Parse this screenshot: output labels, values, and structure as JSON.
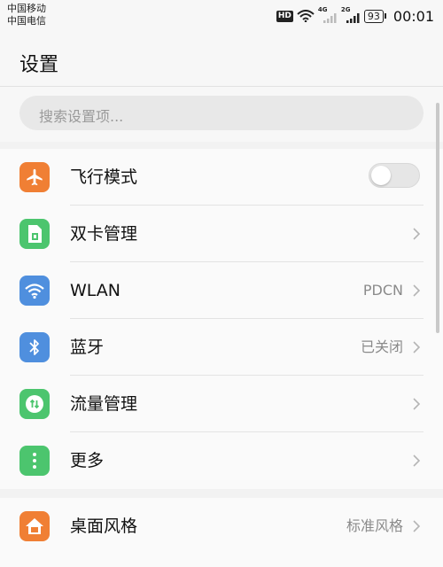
{
  "status_bar": {
    "carrier_1": "中国移动",
    "carrier_2": "中国电信",
    "hd_badge": "HD",
    "network_1": "4G",
    "network_2": "2G",
    "battery": "93",
    "time": "00:01"
  },
  "header": {
    "title": "设置"
  },
  "search": {
    "placeholder": "搜索设置项..."
  },
  "groups": [
    {
      "items": [
        {
          "label": "飞行模式",
          "icon": "airplane-icon",
          "icon_color": "#f07f34",
          "control": "toggle",
          "toggle_on": false
        },
        {
          "label": "双卡管理",
          "icon": "sim-card-icon",
          "icon_color": "#4cc56e",
          "control": "chevron"
        },
        {
          "label": "WLAN",
          "icon": "wifi-icon",
          "icon_color": "#4f8fde",
          "value": "PDCN",
          "control": "chevron"
        },
        {
          "label": "蓝牙",
          "icon": "bluetooth-icon",
          "icon_color": "#4f8fde",
          "value": "已关闭",
          "control": "chevron"
        },
        {
          "label": "流量管理",
          "icon": "data-usage-icon",
          "icon_color": "#4cc56e",
          "control": "chevron"
        },
        {
          "label": "更多",
          "icon": "more-icon",
          "icon_color": "#4cc56e",
          "control": "chevron"
        }
      ]
    },
    {
      "items": [
        {
          "label": "桌面风格",
          "icon": "home-style-icon",
          "icon_color": "#f07f34",
          "value": "标准风格",
          "control": "chevron"
        }
      ]
    }
  ]
}
